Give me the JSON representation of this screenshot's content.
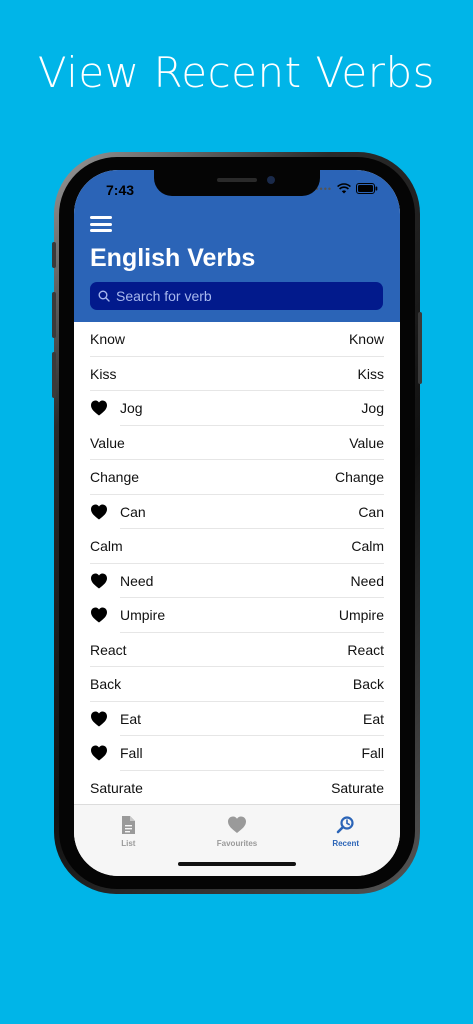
{
  "promo": {
    "title": "View Recent Verbs"
  },
  "status_bar": {
    "time": "7:43"
  },
  "header": {
    "title": "English Verbs"
  },
  "search": {
    "placeholder": "Search for verb"
  },
  "verbs": [
    {
      "left": "Know",
      "right": "Know",
      "favourite": false
    },
    {
      "left": "Kiss",
      "right": "Kiss",
      "favourite": false
    },
    {
      "left": "Jog",
      "right": "Jog",
      "favourite": true
    },
    {
      "left": "Value",
      "right": "Value",
      "favourite": false
    },
    {
      "left": "Change",
      "right": "Change",
      "favourite": false
    },
    {
      "left": "Can",
      "right": "Can",
      "favourite": true
    },
    {
      "left": "Calm",
      "right": "Calm",
      "favourite": false
    },
    {
      "left": "Need",
      "right": "Need",
      "favourite": true
    },
    {
      "left": "Umpire",
      "right": "Umpire",
      "favourite": true
    },
    {
      "left": "React",
      "right": "React",
      "favourite": false
    },
    {
      "left": "Back",
      "right": "Back",
      "favourite": false
    },
    {
      "left": "Eat",
      "right": "Eat",
      "favourite": true
    },
    {
      "left": "Fall",
      "right": "Fall",
      "favourite": true
    },
    {
      "left": "Saturate",
      "right": "Saturate",
      "favourite": false
    }
  ],
  "tabs": [
    {
      "label": "List",
      "icon": "document-icon",
      "active": false
    },
    {
      "label": "Favourites",
      "icon": "heart-icon",
      "active": false
    },
    {
      "label": "Recent",
      "icon": "recent-search-icon",
      "active": true
    }
  ],
  "colors": {
    "background": "#00b5e8",
    "header": "#2b64b7",
    "search_field": "#021a8c",
    "active_tab": "#2b64b7",
    "inactive_tab": "#9a9a9a"
  }
}
